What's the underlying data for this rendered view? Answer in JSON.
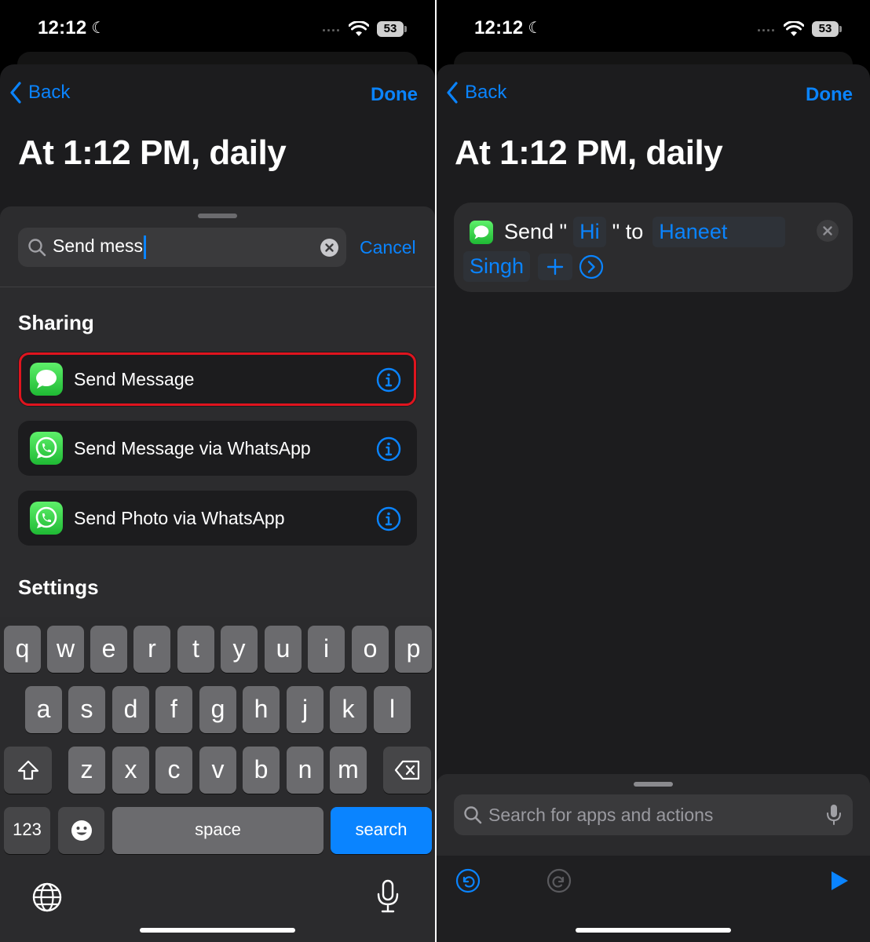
{
  "status_bar": {
    "time": "12:12",
    "battery": "53"
  },
  "left": {
    "nav": {
      "back_label": "Back",
      "done_label": "Done"
    },
    "title": "At 1:12 PM, daily",
    "search": {
      "value": "Send mess",
      "cancel_label": "Cancel"
    },
    "sections": {
      "sharing": "Sharing",
      "settings": "Settings"
    },
    "results": [
      {
        "label": "Send Message",
        "app": "messages"
      },
      {
        "label": "Send Message via WhatsApp",
        "app": "whatsapp"
      },
      {
        "label": "Send Photo via WhatsApp",
        "app": "whatsapp"
      }
    ],
    "keyboard": {
      "row1": [
        "q",
        "w",
        "e",
        "r",
        "t",
        "y",
        "u",
        "i",
        "o",
        "p"
      ],
      "row2": [
        "a",
        "s",
        "d",
        "f",
        "g",
        "h",
        "j",
        "k",
        "l"
      ],
      "row3": [
        "z",
        "x",
        "c",
        "v",
        "b",
        "n",
        "m"
      ],
      "numbers_label": "123",
      "space_label": "space",
      "search_label": "search"
    }
  },
  "right": {
    "nav": {
      "back_label": "Back",
      "done_label": "Done"
    },
    "title": "At 1:12 PM, daily",
    "action": {
      "verb": "Send \"",
      "message_token": "Hi",
      "connector": "\" to",
      "recipient_line1": "Haneet",
      "recipient_line2": "Singh"
    },
    "search_placeholder": "Search for apps and actions"
  },
  "colors": {
    "accent": "#0a84ff",
    "highlight_border": "#e0141e",
    "messages_green": "#34c759"
  }
}
